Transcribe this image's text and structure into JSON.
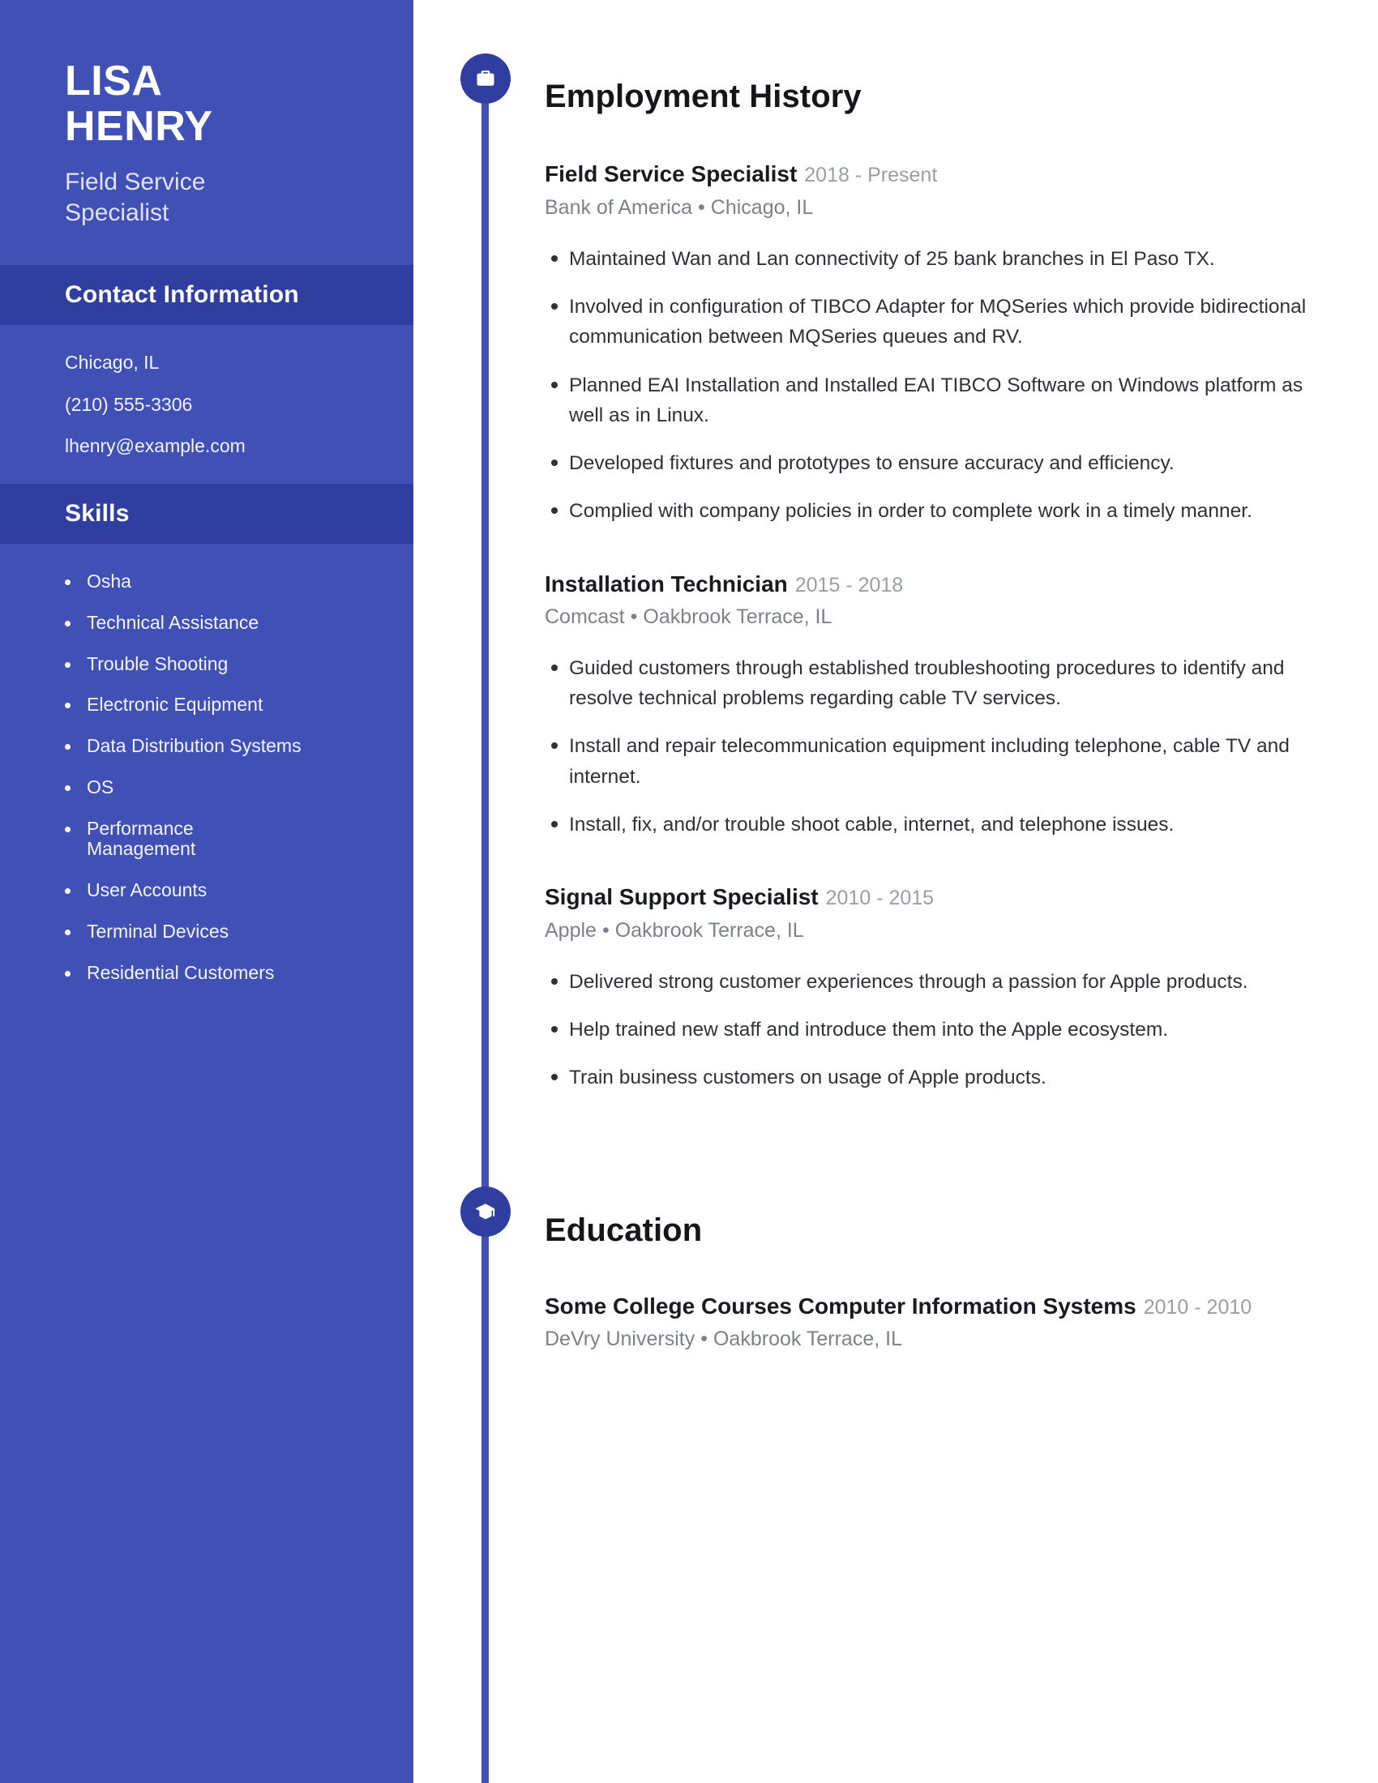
{
  "sidebar": {
    "name_lines": [
      "LISA",
      "HENRY"
    ],
    "role_lines": [
      "Field Service",
      "Specialist"
    ],
    "contact": {
      "heading": "Contact Information",
      "items": [
        "Chicago, IL",
        "(210) 555-3306",
        "lhenry@example.com"
      ]
    },
    "skills": {
      "heading": "Skills",
      "items": [
        "Osha",
        "Technical Assistance",
        "Trouble Shooting",
        "Electronic Equipment",
        "Data Distribution Systems",
        "OS",
        "Performance Management",
        "User Accounts",
        "Terminal Devices",
        "Residential Customers"
      ]
    }
  },
  "main": {
    "employment": {
      "heading": "Employment History",
      "icon": "briefcase-icon",
      "entries": [
        {
          "title": "Field Service Specialist",
          "dates": "2018 - Present",
          "company": "Bank of America",
          "location": "Chicago, IL",
          "bullets": [
            "Maintained Wan and Lan connectivity of 25 bank branches in El Paso TX.",
            "Involved in configuration of TIBCO Adapter for MQSeries which provide bidirectional communication between MQSeries queues and RV.",
            "Planned EAI Installation and Installed EAI TIBCO Software on Windows platform as well as in Linux.",
            "Developed fixtures and prototypes to ensure accuracy and efficiency.",
            "Complied with company policies in order to complete work in a timely manner."
          ]
        },
        {
          "title": "Installation Technician",
          "dates": "2015 - 2018",
          "company": "Comcast",
          "location": "Oakbrook Terrace, IL",
          "bullets": [
            "Guided customers through established troubleshooting procedures to identify and resolve technical problems regarding cable TV services.",
            "Install and repair telecommunication equipment including telephone, cable TV and internet.",
            "Install, fix, and/or trouble shoot cable, internet, and telephone issues."
          ]
        },
        {
          "title": "Signal Support Specialist",
          "dates": "2010 - 2015",
          "company": "Apple",
          "location": "Oakbrook Terrace, IL",
          "bullets": [
            "Delivered strong customer experiences through a passion for Apple products.",
            "Help trained new staff and introduce them into the Apple ecosystem.",
            "Train business customers on usage of Apple products."
          ]
        }
      ]
    },
    "education": {
      "heading": "Education",
      "icon": "graduation-cap-icon",
      "entries": [
        {
          "title": "Some College Courses Computer Information Systems",
          "dates": "2010 - 2010",
          "school": "DeVry University",
          "location": "Oakbrook Terrace, IL"
        }
      ]
    }
  },
  "separator": "•",
  "colors": {
    "sidebar_bg": "#4050b5",
    "sidebar_header_bg": "#303e9f",
    "accent": "#303e9f",
    "body_text": "#2e3138",
    "muted_text": "#7d8189"
  }
}
